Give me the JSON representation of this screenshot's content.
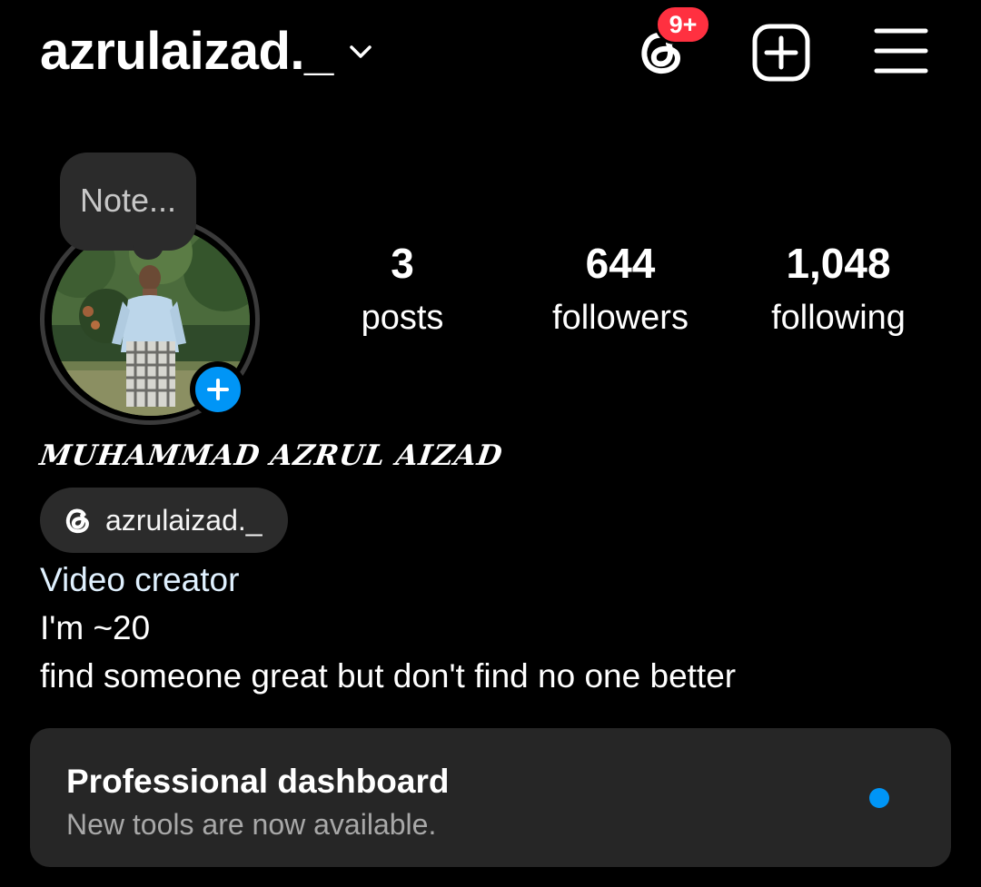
{
  "header": {
    "username": "azrulaizad._",
    "notification_badge": "9+",
    "icons": {
      "switch_account": "chevron-down-icon",
      "threads": "threads-icon",
      "create": "plus-square-icon",
      "menu": "hamburger-menu-icon"
    }
  },
  "profile": {
    "note_placeholder": "Note...",
    "stats": [
      {
        "value": "3",
        "label": "posts"
      },
      {
        "value": "644",
        "label": "followers"
      },
      {
        "value": "1,048",
        "label": "following"
      }
    ],
    "display_name": "MUHAMMAD AZRUL AIZAD",
    "threads_handle": "azrulaizad._",
    "category": "Video creator",
    "bio": [
      "I'm ~20",
      "find someone great but don't find no one better"
    ]
  },
  "dashboard": {
    "title": "Professional dashboard",
    "subtitle": "New tools are now available."
  },
  "colors": {
    "background": "#000000",
    "accent_blue": "#0095f6",
    "badge_red": "#ff3040",
    "card": "#262626"
  }
}
